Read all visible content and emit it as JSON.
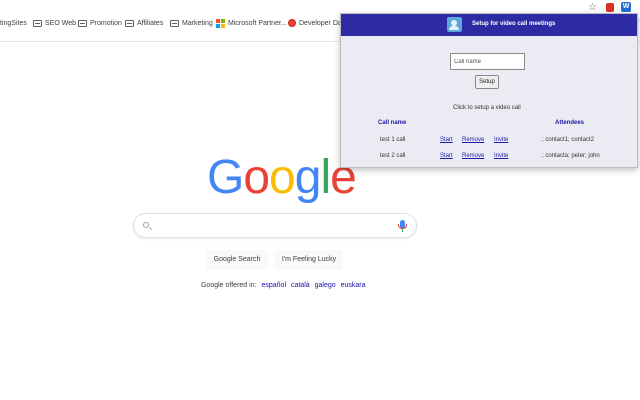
{
  "bookmarks": [
    {
      "label": "tingSites",
      "icon": "folder-icon"
    },
    {
      "label": "SEO Web",
      "icon": "folder-icon"
    },
    {
      "label": "Promotion",
      "icon": "folder-icon"
    },
    {
      "label": "Affiliates",
      "icon": "folder-icon"
    },
    {
      "label": "Marketing",
      "icon": "folder-icon"
    },
    {
      "label": "Microsoft Partner...",
      "icon": "microsoft-icon"
    },
    {
      "label": "Developer Das",
      "icon": "developer-icon"
    }
  ],
  "toolbar": {
    "edge_text": "Im",
    "ext2_label": "W"
  },
  "google": {
    "logo_letters": [
      "G",
      "o",
      "o",
      "g",
      "l",
      "e"
    ],
    "logo_colors": [
      "#4285f4",
      "#ea4335",
      "#fbbc05",
      "#4285f4",
      "#34a853",
      "#ea4335"
    ],
    "search_button": "Google Search",
    "lucky_button": "I'm Feeling Lucky",
    "offered_prefix": "Google offered in:",
    "languages": [
      "español",
      "català",
      "galego",
      "euskara"
    ]
  },
  "popup": {
    "title": "Setup for video call meetings",
    "input_placeholder": "Call name",
    "setup_button": "Setup",
    "hint": "Click to setup a video call",
    "header_name": "Call name",
    "header_attendees": "Attendees",
    "rows": [
      {
        "name": "test 1 call",
        "start": "Start",
        "remove": "Remove",
        "invite": "Invite",
        "attendees": "; contact1; contact2"
      },
      {
        "name": "test 2 call",
        "start": "Start",
        "remove": "Remove",
        "invite": "Invite",
        "attendees": "; contacta; peter; john"
      }
    ]
  },
  "colors": {
    "header_bg": "#2e2aa3",
    "popup_bg": "#ecebf4",
    "link": "#1a1aa6"
  }
}
